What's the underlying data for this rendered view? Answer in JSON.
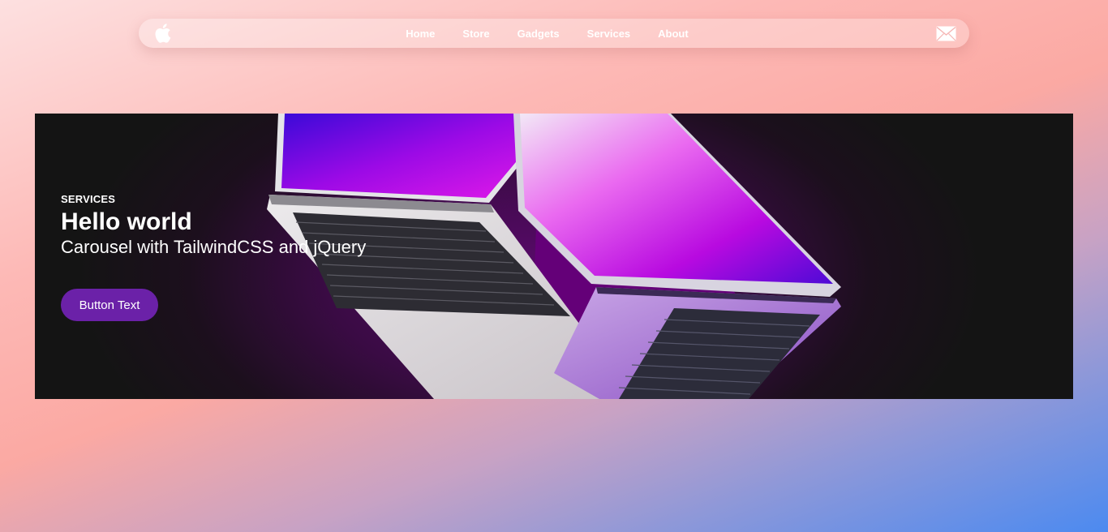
{
  "nav": {
    "logo_icon": "apple-logo-icon",
    "links": [
      "Home",
      "Store",
      "Gadgets",
      "Services",
      "About"
    ],
    "mail_icon": "mail-icon"
  },
  "slide": {
    "tag": "SERVICES",
    "title": "Hello world",
    "subtitle": "Carousel with TailwindCSS and jQuery",
    "button_label": "Button Text"
  },
  "colors": {
    "button": "#6b21a8",
    "carousel_bg": "#141414",
    "gradient_start": "#fde0e0",
    "gradient_end": "#4c8af0"
  }
}
